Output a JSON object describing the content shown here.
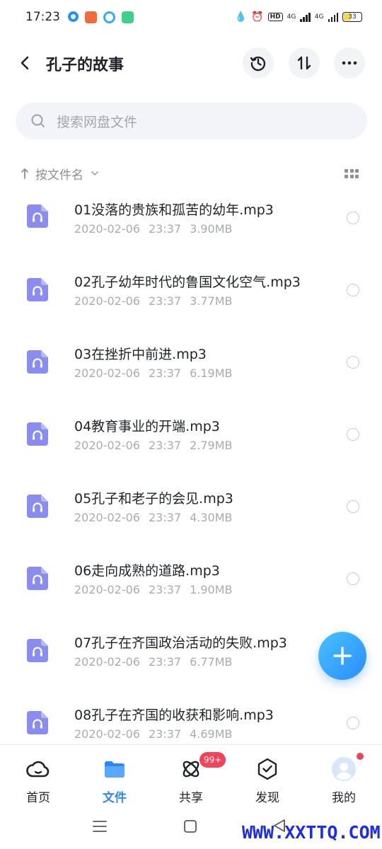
{
  "status_bar": {
    "time": "17:23",
    "app_icons": [
      "#1e90ff",
      "#f06c3a",
      "#34aaff",
      "#3ccf8e"
    ],
    "hd_label": "HD",
    "network_1": "4G",
    "network_2": "4G",
    "battery": "33"
  },
  "header": {
    "title": "孔子的故事",
    "icons": [
      "back-arrow",
      "history-clock",
      "sort-arrows",
      "more-dots"
    ]
  },
  "search": {
    "placeholder": "搜索网盘文件"
  },
  "sort": {
    "label": "按文件名"
  },
  "files": [
    {
      "name": "01没落的贵族和孤苦的幼年.mp3",
      "date": "2020-02-06",
      "time": "23:37",
      "size": "3.90MB"
    },
    {
      "name": "02孔子幼年时代的鲁国文化空气.mp3",
      "date": "2020-02-06",
      "time": "23:37",
      "size": "3.77MB"
    },
    {
      "name": "03在挫折中前进.mp3",
      "date": "2020-02-06",
      "time": "23:37",
      "size": "6.19MB"
    },
    {
      "name": "04教育事业的开端.mp3",
      "date": "2020-02-06",
      "time": "23:37",
      "size": "2.79MB"
    },
    {
      "name": "05孔子和老子的会见.mp3",
      "date": "2020-02-06",
      "time": "23:37",
      "size": "4.30MB"
    },
    {
      "name": "06走向成熟的道路.mp3",
      "date": "2020-02-06",
      "time": "23:37",
      "size": "1.90MB"
    },
    {
      "name": "07孔子在齐国政治活动的失败.mp3",
      "date": "2020-02-06",
      "time": "23:37",
      "size": "6.77MB"
    },
    {
      "name": "08孔子在齐国的收获和影响.mp3",
      "date": "2020-02-06",
      "time": "23:37",
      "size": "4.69MB"
    }
  ],
  "bottom_nav": [
    {
      "label": "首页",
      "icon": "home-cloud-icon",
      "active": false
    },
    {
      "label": "文件",
      "icon": "folder-icon",
      "active": true
    },
    {
      "label": "共享",
      "icon": "share-atom-icon",
      "active": false
    },
    {
      "label": "发现",
      "icon": "discover-icon",
      "active": false
    },
    {
      "label": "我的",
      "icon": "avatar-icon",
      "active": false
    }
  ],
  "share_badge": "99+",
  "colors": {
    "accent": "#2f86f6",
    "audio_icon": "#8b8cf0",
    "badge": "#f2435a",
    "fab": "#3aa8ff"
  },
  "watermark": "WWW.XXTTQ.COM"
}
